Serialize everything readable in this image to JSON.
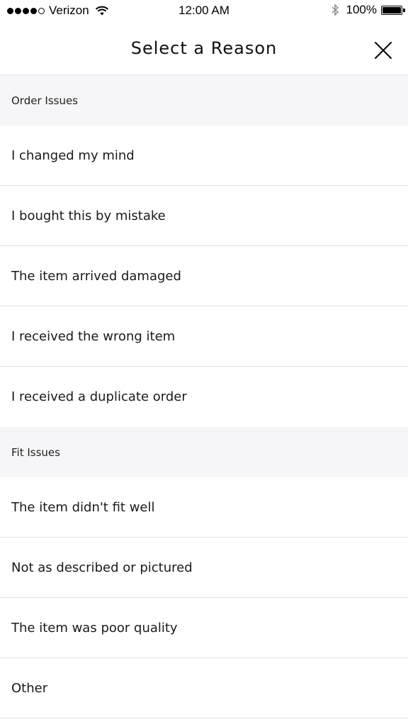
{
  "status_bar": {
    "carrier": "Verizon",
    "time": "12:00 AM",
    "battery": "100%"
  },
  "header": {
    "title": "Select a Reason",
    "close_icon": "close-icon"
  },
  "sections": [
    {
      "title": "Order Issues",
      "items": [
        "I changed my mind",
        "I bought this by mistake",
        "The item arrived damaged",
        "I received the wrong item",
        "I received a duplicate order"
      ]
    },
    {
      "title": "Fit Issues",
      "items": [
        "The item didn't fit well",
        "Not as described or pictured",
        "The item was poor quality",
        "Other"
      ]
    }
  ]
}
